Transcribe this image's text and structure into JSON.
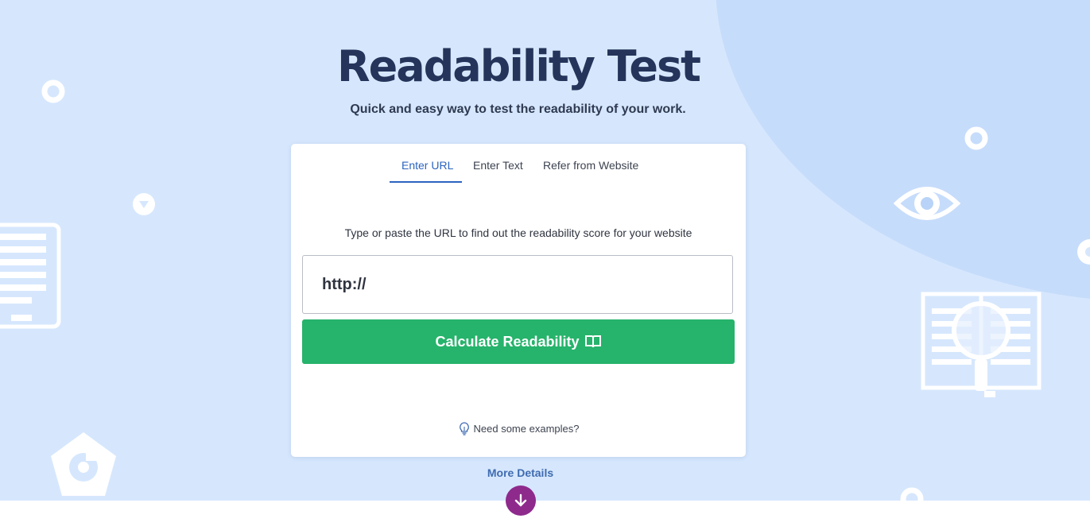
{
  "hero": {
    "title": "Readability Test",
    "subtitle": "Quick and easy way to test the readability of your work."
  },
  "tabs": [
    {
      "label": "Enter URL",
      "active": true
    },
    {
      "label": "Enter Text",
      "active": false
    },
    {
      "label": "Refer from Website",
      "active": false
    }
  ],
  "form": {
    "instruction": "Type or paste the URL to find out the readability score for your website",
    "url_placeholder": "http://",
    "url_value": "",
    "submit_label": "Calculate Readability",
    "submit_icon": "open-book-icon",
    "examples_label": "Need some examples?",
    "examples_icon": "lightbulb-icon"
  },
  "footer": {
    "more_details_label": "More Details",
    "scroll_icon": "arrow-down-icon"
  },
  "colors": {
    "hero_background": "#d6e7fd",
    "title": "#24345a",
    "active_tab": "#2c64c0",
    "submit_button": "#26b36b",
    "more_details": "#3f6bb0",
    "scroll_button": "#8e2a8c"
  }
}
